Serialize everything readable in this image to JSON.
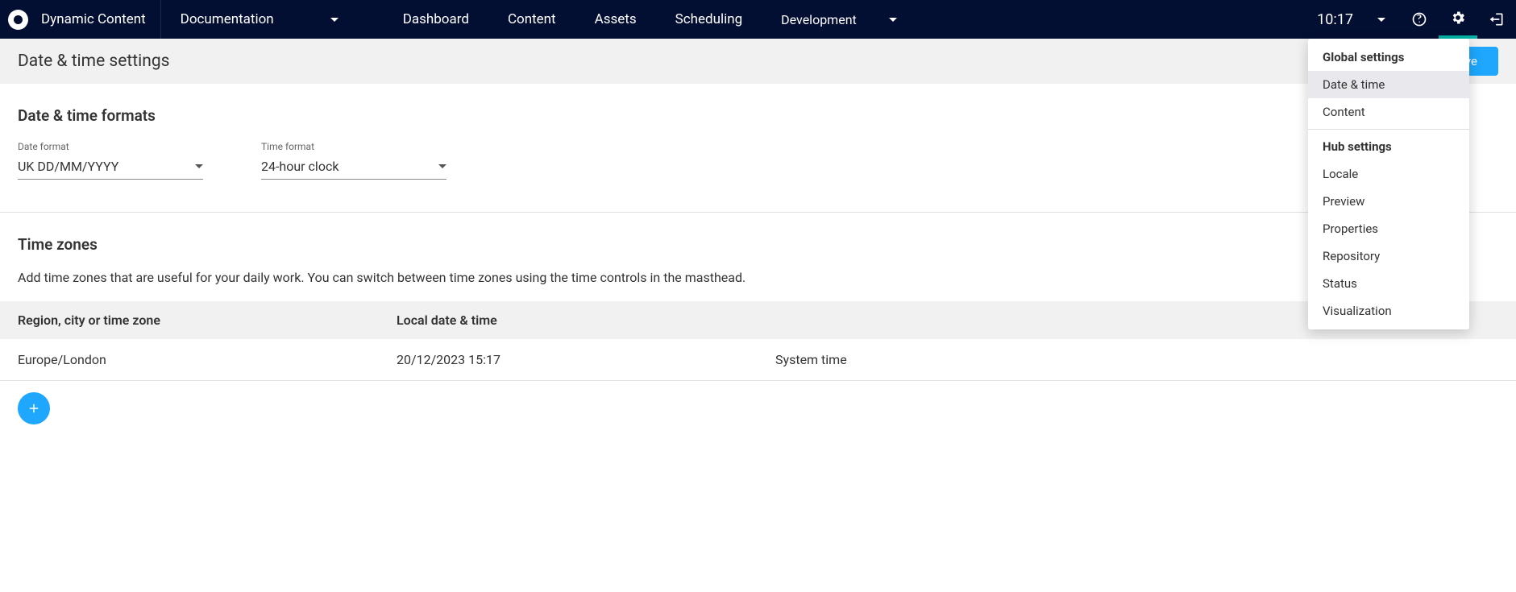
{
  "header": {
    "app_title": "Dynamic Content",
    "org": "Documentation",
    "nav": [
      "Dashboard",
      "Content",
      "Assets",
      "Scheduling"
    ],
    "dev": "Development",
    "time": "10:17"
  },
  "page": {
    "title": "Date & time settings",
    "save_label": "Save"
  },
  "formats": {
    "section_title": "Date & time formats",
    "date_label": "Date format",
    "date_value": "UK DD/MM/YYYY",
    "time_label": "Time format",
    "time_value": "24-hour clock"
  },
  "zones": {
    "section_title": "Time zones",
    "subtext": "Add time zones that are useful for your daily work. You can switch between time zones using the time controls in the masthead.",
    "cols": [
      "Region, city or time zone",
      "Local date & time"
    ],
    "row": {
      "region": "Europe/London",
      "local": "20/12/2023 15:17",
      "tag": "System time"
    }
  },
  "menu": {
    "global_title": "Global settings",
    "global_items": [
      "Date & time",
      "Content"
    ],
    "hub_title": "Hub settings",
    "hub_items": [
      "Locale",
      "Preview",
      "Properties",
      "Repository",
      "Status",
      "Visualization"
    ]
  }
}
